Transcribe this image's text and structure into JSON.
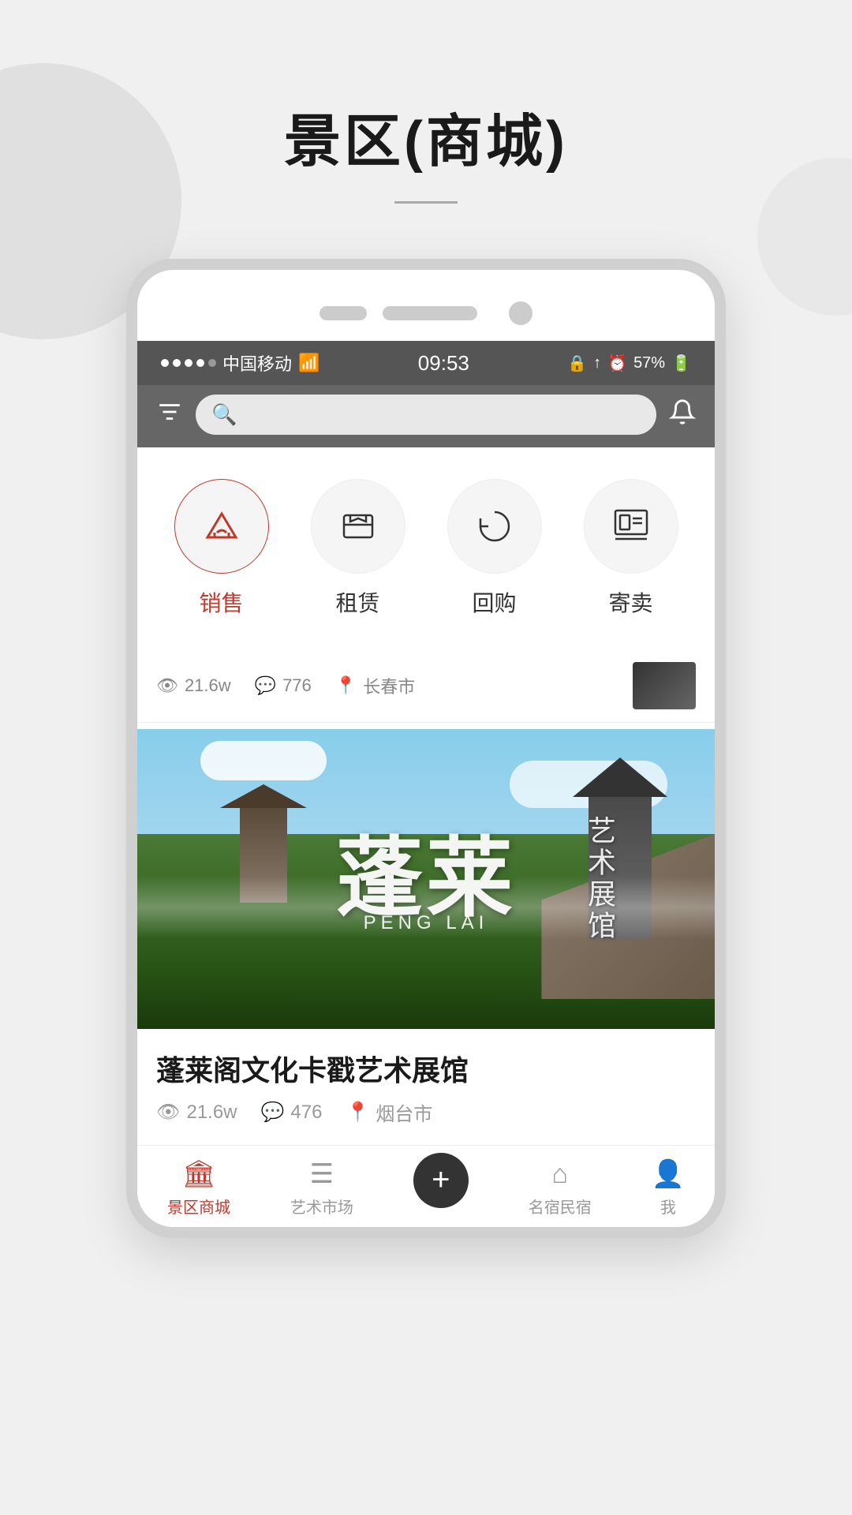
{
  "page": {
    "title": "景区(商城)",
    "divider": true
  },
  "status_bar": {
    "carrier": "中国移动",
    "signal": "●●●●○",
    "wifi": "WiFi",
    "time": "09:53",
    "lock_icon": "🔒",
    "gps_icon": "↑",
    "alarm_icon": "⏰",
    "battery": "57%"
  },
  "search_bar": {
    "filter_label": "filter",
    "placeholder": "",
    "bell_label": "bell"
  },
  "categories": [
    {
      "id": "sales",
      "label": "销售",
      "active": true,
      "icon": "trophy"
    },
    {
      "id": "rental",
      "label": "租赁",
      "active": false,
      "icon": "shop"
    },
    {
      "id": "buyback",
      "label": "回购",
      "active": false,
      "icon": "refresh"
    },
    {
      "id": "consign",
      "label": "寄卖",
      "active": false,
      "icon": "tag"
    }
  ],
  "partial_stats": {
    "views": "21.6w",
    "comments": "776",
    "location": "长春市"
  },
  "main_card": {
    "image_text_big": "蓬莱",
    "image_text_latin": "PENG LAI",
    "image_text_side": "艺术展馆",
    "title": "蓬莱阁文化卡戳艺术展馆",
    "views": "21.6w",
    "comments": "476",
    "location": "烟台市"
  },
  "bottom_tabs": [
    {
      "id": "scenic",
      "label": "景区商城",
      "icon": "🏛",
      "active": true
    },
    {
      "id": "art",
      "label": "艺术市场",
      "icon": "☰",
      "active": false
    },
    {
      "id": "add",
      "label": "+",
      "icon": "+",
      "active": false
    },
    {
      "id": "home",
      "label": "名宿民宿",
      "icon": "⌂",
      "active": false
    },
    {
      "id": "me",
      "label": "我",
      "icon": "👤",
      "active": false
    }
  ]
}
